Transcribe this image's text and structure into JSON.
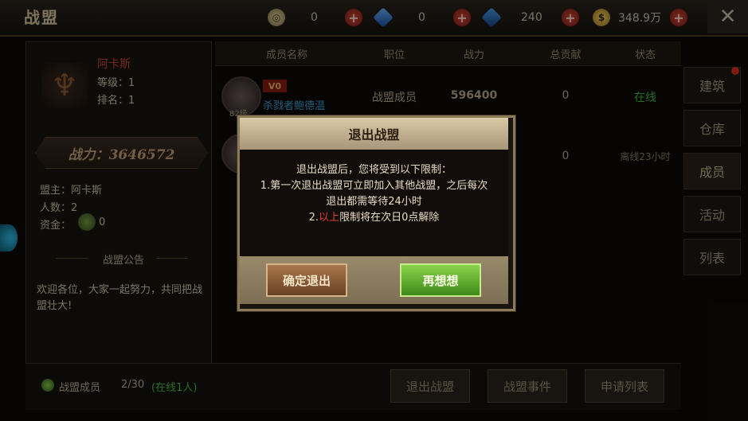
{
  "header": {
    "title": "战盟",
    "resources": [
      {
        "icon": "coin-icon",
        "value": "0"
      },
      {
        "icon": "gem-icon",
        "value": "0"
      },
      {
        "icon": "crystal-icon",
        "value": "240"
      },
      {
        "icon": "gold-icon",
        "value": "348.9万"
      }
    ],
    "plus": "+",
    "close": "✕"
  },
  "guild": {
    "name": "阿卡斯",
    "level": "等级：1",
    "rank": "排名：1",
    "power": "战力：3646572",
    "leader": "盟主：阿卡斯",
    "members": "人数：2",
    "funds_label": "资金：",
    "funds_value": "0",
    "announcement_title": "战盟公告",
    "announcement_text": "欢迎各位，大家一起努力，共同把战盟壮大!"
  },
  "table": {
    "columns": [
      "成员名称",
      "职位",
      "战力",
      "总贡献",
      "状态"
    ],
    "rows": [
      {
        "vip": "V0",
        "name": "杀戮者鲍德温",
        "level": "82级",
        "position": "战盟成员",
        "power": "596400",
        "contribution": "0",
        "status": "在线"
      },
      {
        "vip": "",
        "name": "",
        "level": "",
        "position": "",
        "power": "",
        "contribution": "0",
        "status": "离线23小时"
      }
    ]
  },
  "side_tabs": [
    "建筑",
    "仓库",
    "成员",
    "活动",
    "列表"
  ],
  "bottom": {
    "members_label": "战盟成员",
    "members_count": "2/30",
    "online": "(在线1人)",
    "buttons": [
      "退出战盟",
      "战盟事件",
      "申请列表"
    ]
  },
  "dialog": {
    "title": "退出战盟",
    "line1": "退出战盟后，您将受到以下限制：",
    "line2": "1.第一次退出战盟可立即加入其他战盟，之后每次",
    "line3": "退出都需等待24小时",
    "line4_prefix": "2.",
    "line4_highlight": "以上",
    "line4_suffix": "限制将在次日0点解除",
    "confirm": "确定退出",
    "cancel": "再想想"
  },
  "colors": {
    "highlight_red": "#e0402a",
    "online_green": "#3fbf3a"
  }
}
